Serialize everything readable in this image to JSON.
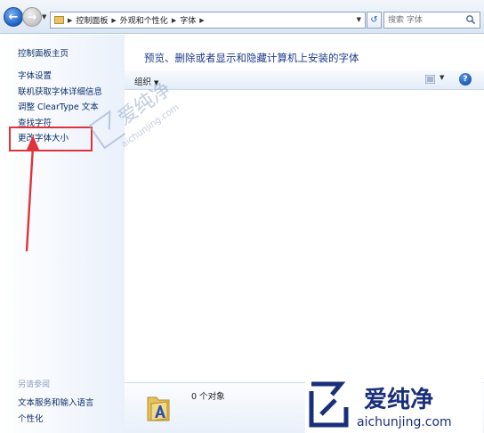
{
  "window": {
    "address_path": [
      "控制面板",
      "外观和个性化",
      "字体"
    ],
    "search_placeholder": "搜索 字体"
  },
  "sidebar": {
    "home_link": "控制面板主页",
    "links": [
      "字体设置",
      "联机获取字体详细信息",
      "调整 ClearType 文本",
      "查找字符",
      "更改字体大小"
    ],
    "see_also_title": "另请参阅",
    "see_also_links": [
      "文本服务和输入语言",
      "个性化"
    ]
  },
  "main": {
    "description": "预览、删除或者显示和隐藏计算机上安装的字体",
    "toolbar": {
      "organize_label": "组织"
    }
  },
  "details": {
    "count_text": "0 个对象"
  },
  "watermark": {
    "site_name": "爱纯净",
    "site_url": "aichunjing.com"
  },
  "colors": {
    "annotation_red": "#e1323b",
    "link_blue": "#0e2e6b",
    "title_blue": "#1e3b8a"
  },
  "icons": [
    "back-arrow-icon",
    "forward-arrow-icon",
    "folder-icon",
    "refresh-icon",
    "search-icon",
    "view-icon",
    "help-icon",
    "font-folder-icon"
  ]
}
